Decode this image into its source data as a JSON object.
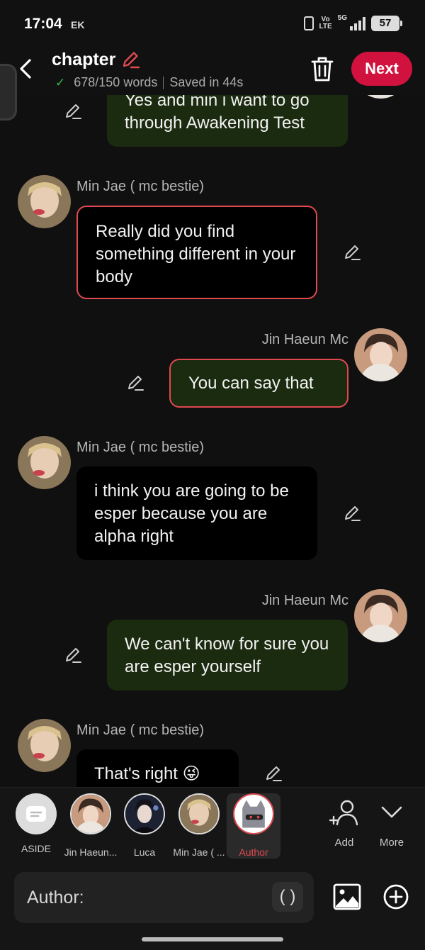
{
  "status_bar": {
    "time": "17:04",
    "carrier": "EK",
    "volte": "Vo\nLTE",
    "network": "5G",
    "battery": "57"
  },
  "header": {
    "title": "chapter",
    "word_count": "678/150 words",
    "saved": "Saved in 44s",
    "next_label": "Next"
  },
  "messages": [
    {
      "side": "right",
      "text": "Yes and min i want to go through Awakening Test"
    },
    {
      "side": "left",
      "name": "Min Jae ( mc bestie)",
      "text": "Really did you find something different in your body"
    },
    {
      "side": "right",
      "name": "Jin Haeun Mc",
      "text": "You can say that"
    },
    {
      "side": "left",
      "name": "Min Jae ( mc bestie)",
      "text": "i think you are going to be esper because you are alpha right"
    },
    {
      "side": "right",
      "name": "Jin Haeun Mc",
      "text": "We can't know for sure you are esper yourself"
    },
    {
      "side": "left",
      "name": "Min Jae ( mc bestie)",
      "text": "That's right 😜"
    }
  ],
  "characters": [
    {
      "label": "ASIDE"
    },
    {
      "label": "Jin Haeun..."
    },
    {
      "label": "Luca"
    },
    {
      "label": "Min Jae ( ..."
    },
    {
      "label": "Author",
      "selected": true
    }
  ],
  "tools": {
    "add_label": "Add",
    "more_label": "More"
  },
  "input": {
    "label": "Author:",
    "paren": "( )"
  },
  "colors": {
    "accent": "#d1123f",
    "selection": "#e0494f",
    "right_bubble": "#1b2b10",
    "left_bubble": "#000000",
    "saved_check": "#39b54a"
  }
}
